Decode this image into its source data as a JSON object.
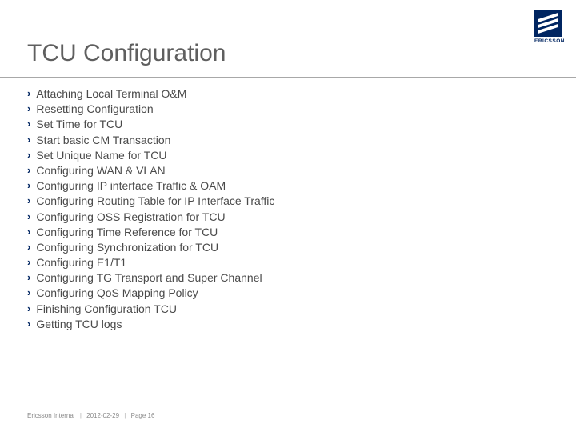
{
  "logo": {
    "text": "ERICSSON"
  },
  "title": "TCU Configuration",
  "bullets": [
    "Attaching Local Terminal O&M",
    "Resetting Configuration",
    "Set Time for TCU",
    "Start basic CM Transaction",
    "Set Unique Name for TCU",
    "Configuring WAN & VLAN",
    "Configuring IP interface Traffic & OAM",
    "Configuring Routing Table for IP Interface Traffic",
    "Configuring OSS Registration for TCU",
    "Configuring Time Reference for TCU",
    "Configuring Synchronization for TCU",
    "Configuring E1/T1",
    "Configuring TG Transport and Super Channel",
    "Configuring QoS Mapping Policy",
    "Finishing Configuration TCU",
    "Getting TCU logs"
  ],
  "footer": {
    "classification": "Ericsson Internal",
    "date": "2012-02-29",
    "page_label": "Page ",
    "page_number": "16"
  }
}
